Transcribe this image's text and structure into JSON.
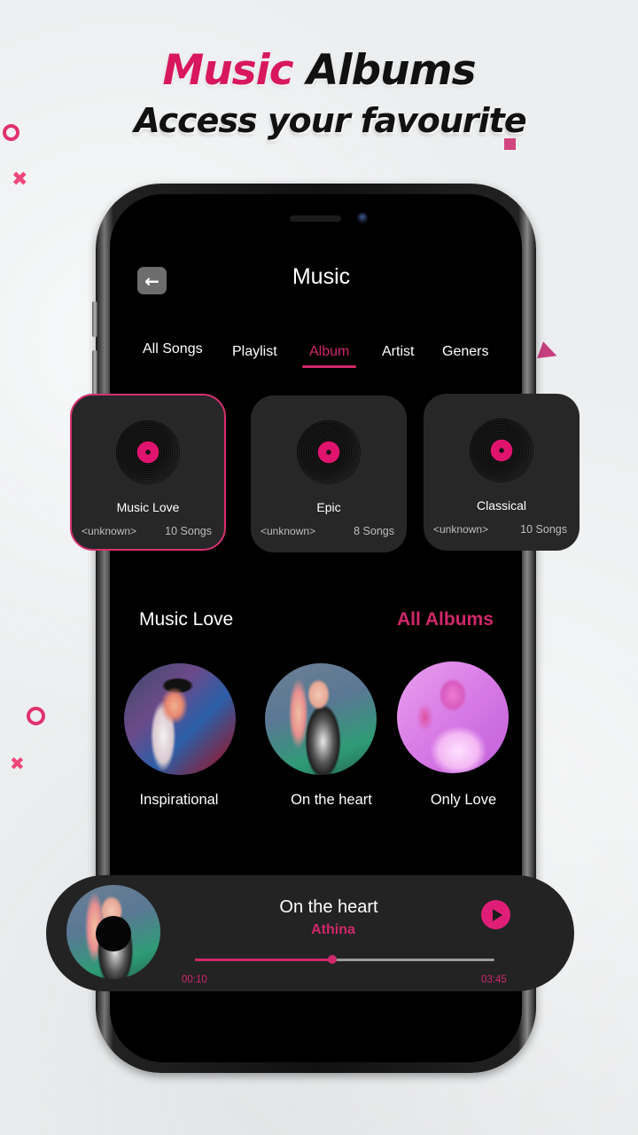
{
  "promo": {
    "title_accent": "Music",
    "title_rest": " Albums",
    "subtitle": "Access your favourite"
  },
  "colors": {
    "accent": "#d0286a",
    "card_bg": "#272727",
    "screen_bg": "#000000",
    "player_bg": "#232323"
  },
  "header": {
    "back_icon": "←",
    "title": "Music"
  },
  "tabs": [
    {
      "label": "All Songs",
      "active": false
    },
    {
      "label": "Playlist",
      "active": false
    },
    {
      "label": "Album",
      "active": true
    },
    {
      "label": "Artist",
      "active": false
    },
    {
      "label": "Geners",
      "active": false
    }
  ],
  "albums": [
    {
      "name": "Music Love",
      "artist": "<unknown>",
      "count": "10 Songs",
      "selected": true
    },
    {
      "name": "Epic",
      "artist": "<unknown>",
      "count": "8 Songs",
      "selected": false
    },
    {
      "name": "Classical",
      "artist": "<unknown>",
      "count": "10 Songs",
      "selected": false
    }
  ],
  "section": {
    "title": "Music Love",
    "link": "All Albums"
  },
  "songs": [
    {
      "label": "Inspirational"
    },
    {
      "label": "On the heart"
    },
    {
      "label": "Only Love"
    }
  ],
  "player": {
    "title": "On the heart",
    "artist": "Athina",
    "elapsed": "00:10",
    "duration": "03:45",
    "progress_percent": 46,
    "play_icon": "play"
  }
}
